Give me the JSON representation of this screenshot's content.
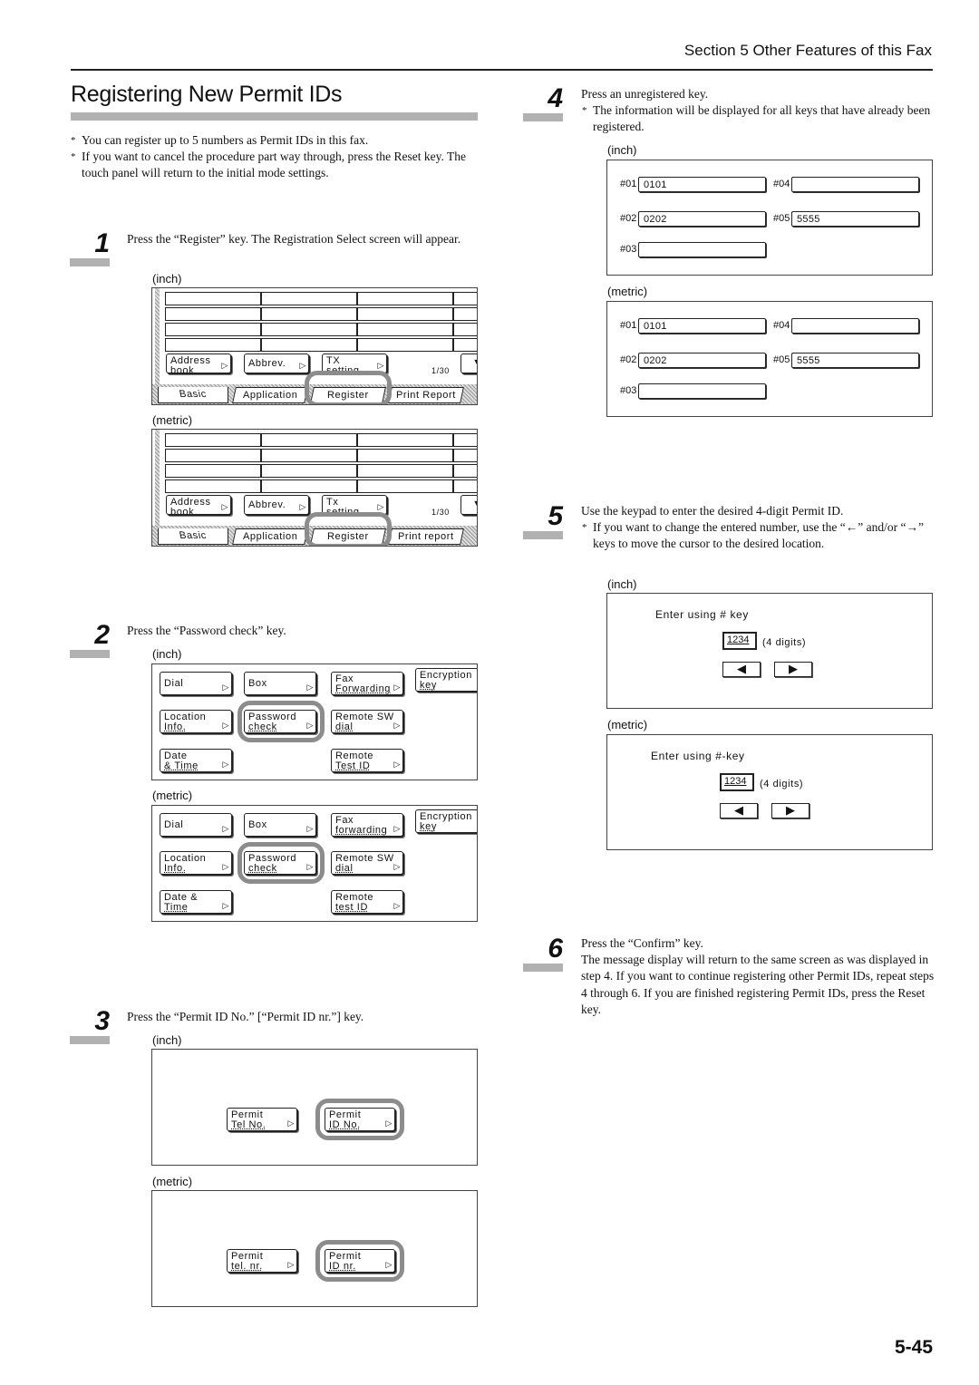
{
  "header": {
    "section": "Section 5  Other Features of this Fax",
    "title": "Registering New Permit IDs"
  },
  "notes": [
    "You can register up to 5 numbers as Permit IDs in this fax.",
    "If you want to cancel the procedure part way through, press the Reset key. The touch panel will return to the initial mode settings."
  ],
  "note_bullet": "*",
  "steps": [
    {
      "number": "1",
      "text": "Press the “Register” key. The Registration Select screen will appear."
    },
    {
      "number": "2",
      "text": "Press the “Password check” key."
    },
    {
      "number": "3",
      "text": "Press the “Permit ID No.” [“Permit ID nr.”] key."
    },
    {
      "number": "4",
      "text": "Press an unregistered key.",
      "note": "The information will be displayed for all keys that have already been registered."
    },
    {
      "number": "5",
      "text": "Use the keypad to enter the desired 4-digit Permit ID.",
      "note": "If you want to change the entered number, use the “←” and/or “→” keys to move the cursor to the desired location."
    },
    {
      "number": "6",
      "text": "Press the “Confirm” key.",
      "text2": "The message display will return to the same screen as was displayed in step 4. If you want to continue registering other Permit IDs, repeat steps 4 through 6. If you are finished registering Permit IDs, press the Reset key."
    }
  ],
  "units": {
    "inch": "(inch)",
    "metric": "(metric)"
  },
  "step1_screens": {
    "inch": {
      "buttons": [
        {
          "l1": "Address",
          "l2": "book"
        },
        {
          "l1": "Abbrev.",
          "l2": ""
        },
        {
          "l1": "TX",
          "l2": "setting"
        }
      ],
      "page": "1/30",
      "tabs": [
        "Basic",
        "Application",
        "Register",
        "Print Report"
      ]
    },
    "metric": {
      "buttons": [
        {
          "l1": "Address",
          "l2": "book"
        },
        {
          "l1": "Abbrev.",
          "l2": ""
        },
        {
          "l1": "Tx",
          "l2": "setting"
        }
      ],
      "page": "1/30",
      "tabs": [
        "Basic",
        "Application",
        "Register",
        "Print report"
      ]
    }
  },
  "step2_screens": {
    "inch": {
      "buttons": [
        {
          "l1": "Dial",
          "l2": ""
        },
        {
          "l1": "Box",
          "l2": ""
        },
        {
          "l1": "Fax",
          "l2": "Forwarding"
        },
        {
          "l1": "Encryption",
          "l2": "key"
        },
        {
          "l1": "Location",
          "l2": "Info."
        },
        {
          "l1": "Password",
          "l2": "check"
        },
        {
          "l1": "Remote SW",
          "l2": "dial"
        },
        {
          "l1": "Date",
          "l2": "& Time"
        },
        {
          "l1": "Remote",
          "l2": "Test ID"
        }
      ]
    },
    "metric": {
      "buttons": [
        {
          "l1": "Dial",
          "l2": ""
        },
        {
          "l1": "Box",
          "l2": ""
        },
        {
          "l1": "Fax",
          "l2": "forwarding"
        },
        {
          "l1": "Encryption",
          "l2": "key"
        },
        {
          "l1": "Location",
          "l2": "Info."
        },
        {
          "l1": "Password",
          "l2": "check"
        },
        {
          "l1": "Remote SW",
          "l2": "dial"
        },
        {
          "l1": "Date &",
          "l2": "Time"
        },
        {
          "l1": "Remote",
          "l2": "test ID"
        }
      ]
    }
  },
  "step3_screens": {
    "inch": {
      "buttons": [
        {
          "l1": "Permit",
          "l2": "Tel No."
        },
        {
          "l1": "Permit",
          "l2": "ID No."
        }
      ]
    },
    "metric": {
      "buttons": [
        {
          "l1": "Permit",
          "l2": "tel. nr."
        },
        {
          "l1": "Permit",
          "l2": "ID nr."
        }
      ]
    }
  },
  "step4_screens": {
    "inch": {
      "slots": [
        {
          "label": "#01",
          "value": "0101"
        },
        {
          "label": "#02",
          "value": "0202"
        },
        {
          "label": "#03",
          "value": ""
        },
        {
          "label": "#04",
          "value": ""
        },
        {
          "label": "#05",
          "value": "5555"
        }
      ]
    },
    "metric": {
      "slots": [
        {
          "label": "#01",
          "value": "0101"
        },
        {
          "label": "#02",
          "value": "0202"
        },
        {
          "label": "#03",
          "value": ""
        },
        {
          "label": "#04",
          "value": ""
        },
        {
          "label": "#05",
          "value": "5555"
        }
      ]
    }
  },
  "step5_screens": {
    "inch": {
      "prompt": "Enter using # key",
      "value": "1234",
      "hint": "(4 digits)",
      "left": "◀",
      "right": "▶"
    },
    "metric": {
      "prompt": "Enter using #-key",
      "value": "1234",
      "hint": "(4 digits)",
      "left": "◀",
      "right": "▶"
    }
  },
  "page_number": "5-45"
}
